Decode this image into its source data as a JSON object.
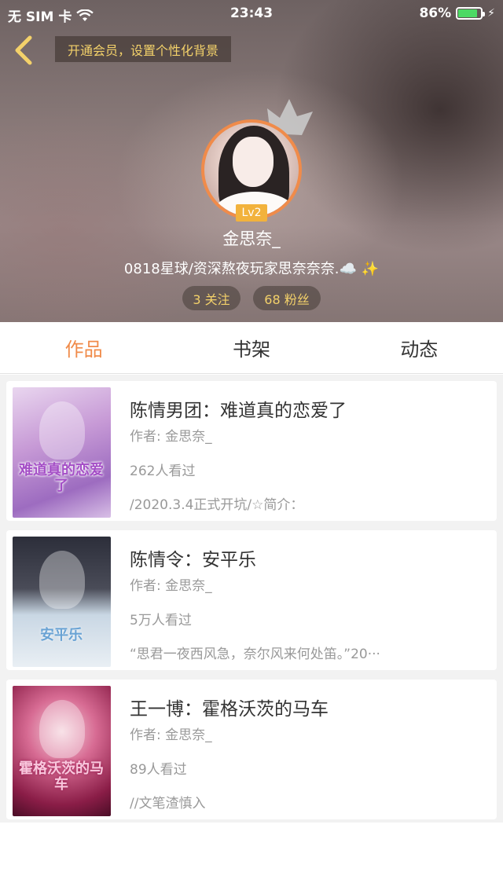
{
  "status_bar": {
    "carrier": "无 SIM 卡",
    "time": "23:43",
    "battery": "86%",
    "battery_level": 0.86
  },
  "header": {
    "vip_banner": "开通会员，设置个性化背景",
    "level": "Lv2",
    "username": "金思奈_",
    "bio": "0818星球/资深熬夜玩家思奈奈奈.☁️ ✨",
    "following": "3 关注",
    "fans": "68 粉丝"
  },
  "tabs": [
    {
      "label": "作品",
      "active": true
    },
    {
      "label": "书架",
      "active": false
    },
    {
      "label": "动态",
      "active": false
    }
  ],
  "books": [
    {
      "title": "陈情男团：难道真的恋爱了",
      "author": "作者: 金思奈_",
      "views": "262人看过",
      "intro": "/2020.3.4正式开坑/☆简介：",
      "cover_text": "难道真的恋爱了"
    },
    {
      "title": "陈情令：安平乐",
      "author": "作者: 金思奈_",
      "views": "5万人看过",
      "intro": "“思君一夜西风急，奈尔风来何处笛。”20···",
      "cover_text": "安平乐"
    },
    {
      "title": "王一博：霍格沃茨的马车",
      "author": "作者: 金思奈_",
      "views": "89人看过",
      "intro": "//文笔渣慎入",
      "cover_text": "霍格沃茨的马车"
    }
  ],
  "colors": {
    "accent": "#f08b4a",
    "vip_gold": "#f3d16a",
    "level_badge": "#f2b23c"
  }
}
